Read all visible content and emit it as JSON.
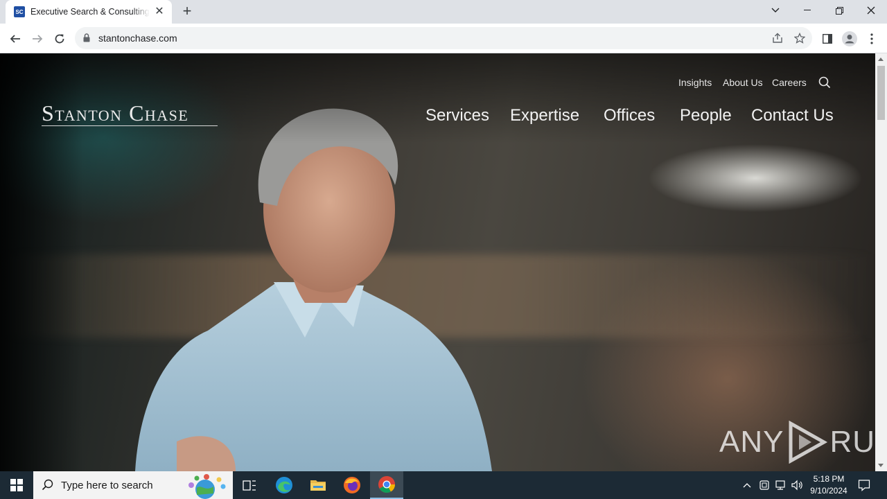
{
  "browser": {
    "tab": {
      "favicon_text": "SC",
      "title": "Executive Search & Consulting Firm"
    },
    "url": "stantonchase.com",
    "icons": [
      "back-icon",
      "forward-icon",
      "reload-icon",
      "lock-icon",
      "share-icon",
      "star-icon",
      "sidepanel-icon",
      "profile-icon",
      "menu-icon"
    ]
  },
  "site": {
    "logo": "Stanton Chase",
    "utility_nav": [
      "Insights",
      "About Us",
      "Careers"
    ],
    "main_nav": [
      "Services",
      "Expertise",
      "Offices",
      "People",
      "Contact Us"
    ]
  },
  "watermark": {
    "left": "ANY",
    "right": "RUN"
  },
  "taskbar": {
    "search_placeholder": "Type here to search",
    "time": "5:18 PM",
    "date": "9/10/2024"
  },
  "colors": {
    "accent": "#1a73e8",
    "taskbar": "#1c2a35",
    "favicon": "#1f4fa3"
  }
}
